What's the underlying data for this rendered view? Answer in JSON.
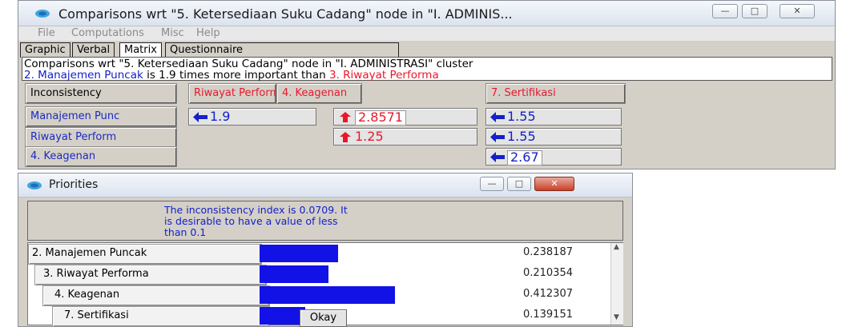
{
  "main_window": {
    "title": "Comparisons wrt \"5. Ketersediaan Suku Cadang\" node in \"I. ADMINIS...",
    "menu": [
      "File",
      "Computations",
      "Misc",
      "Help"
    ],
    "tabs": [
      "Graphic",
      "Verbal",
      "Matrix",
      "Questionnaire"
    ],
    "active_tab": "Matrix",
    "info_line1": "Comparisons wrt \"5. Ketersediaan Suku Cadang\" node in \"I. ADMINISTRASI\" cluster",
    "info_line2": {
      "part1": "2. Manajemen Puncak",
      "part2": " is 1.9 times more important than ",
      "part3": "3. Riwayat Performa"
    },
    "matrix": {
      "corner": "Inconsistency",
      "columns": [
        "Riwayat Perform",
        "4. Keagenan",
        "7. Sertifikasi"
      ],
      "rows": [
        "Manajemen Punc",
        "Riwayat Perform",
        "4. Keagenan"
      ],
      "cells": [
        [
          {
            "arrow": "left",
            "value": "1.9",
            "color": "#1420c8"
          },
          {
            "arrow": "up",
            "value": "2.8571",
            "color": "#e8182c"
          },
          {
            "arrow": "left",
            "value": "1.55",
            "color": "#1420c8"
          }
        ],
        [
          null,
          {
            "arrow": "up",
            "value": "1.25",
            "color": "#e8182c"
          },
          {
            "arrow": "left",
            "value": "1.55",
            "color": "#1420c8"
          }
        ],
        [
          null,
          null,
          {
            "arrow": "left",
            "value": "2.67",
            "color": "#1420c8"
          }
        ]
      ]
    }
  },
  "priorities_window": {
    "title": "Priorities",
    "message": "The inconsistency index is 0.0709.  It is desirable to have a value of less than 0.1",
    "items": [
      {
        "label": "2. Manajemen Puncak",
        "value": "0.238187",
        "fraction": 0.238187
      },
      {
        "label": "3. Riwayat Performa",
        "value": "0.210354",
        "fraction": 0.210354
      },
      {
        "label": "4. Keagenan",
        "value": "0.412307",
        "fraction": 0.412307
      },
      {
        "label": "7. Sertifikasi",
        "value": "0.139151",
        "fraction": 0.139151
      }
    ],
    "okay_label": "Okay"
  },
  "colors": {
    "bar": "#1212e6",
    "accent_red": "#e8182c",
    "accent_blue": "#1420c8"
  }
}
